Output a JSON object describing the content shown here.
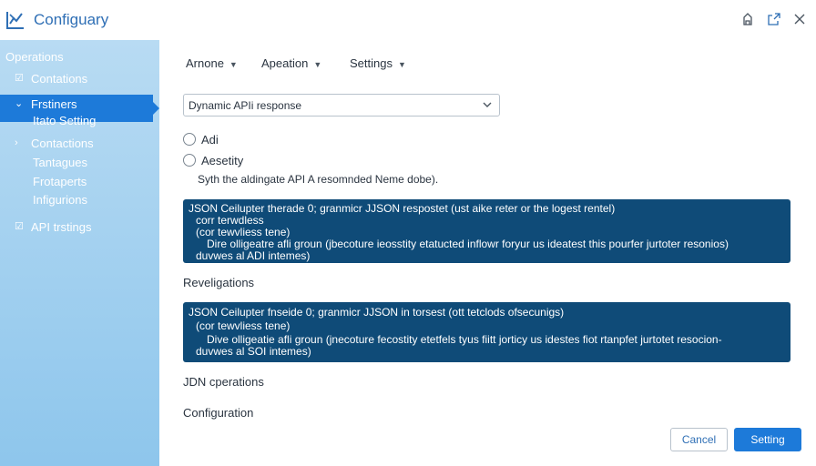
{
  "app": {
    "title": "Configuary",
    "logo_icon": "chart-logo-icon"
  },
  "window": {
    "icons": [
      "pin-icon",
      "popout-icon",
      "close-icon"
    ]
  },
  "sidebar": {
    "heading": "Operations",
    "items": [
      {
        "label": "Contations",
        "icon": "checkbox-icon"
      },
      {
        "label": "Frstiners",
        "icon": "chevron-down-icon"
      },
      {
        "label": "Contactions",
        "icon": "chevron-right-icon"
      },
      {
        "label": "API trstings",
        "icon": "checkbox-icon"
      }
    ],
    "sub_active": "Itato Setting",
    "subitems": [
      "Tantagues",
      "Frotaperts",
      "Infigurions"
    ],
    "active_color": "#1d7ad9"
  },
  "menus": [
    {
      "label": "Arnone"
    },
    {
      "label": "Apeation"
    },
    {
      "label": "Settings"
    }
  ],
  "select": {
    "value": "Dynamic APIi response"
  },
  "radios": [
    {
      "label": "Adi"
    },
    {
      "label": "Aesetity"
    }
  ],
  "hint": "Syth the aldingate API A resomnded Nemе dobe).",
  "code1": {
    "line1": "JSON Ceilupter therade 0; granmicr JJSON respostet (ust aike reter or the logest rentel)",
    "line2": "corr terwdless",
    "line3": "(cor tewvliess tene)",
    "line4": "Dire olligeatre afli groun (jbecoture ieosstity etatucted inflowr foryur us ideatest this pourfer jurtoter resonios)",
    "line5": "duvwes al ADI intemes)"
  },
  "section1": "Reveligations",
  "code2": {
    "line1": "JSON Ceilupter fnseide 0; granmicr JJSON in torsest (ott tetclods ofsecunigs)",
    "line2": "(cor tewvliess tene)",
    "line3": "Dive olligeatie afli groun (jnecoture fecostity etetfels tyus fiitt jorticy us idestes fiot rtanpfet jurtotet resocion-",
    "line4": "duvwes al SOI intemes)"
  },
  "section2": "JDN cperations",
  "section3": "Configuration",
  "buttons": {
    "cancel": "Cancel",
    "primary": "Setting"
  },
  "colors": {
    "accent": "#1d7ad9",
    "code_bg": "#0f4b78",
    "title": "#2f6fb5"
  }
}
